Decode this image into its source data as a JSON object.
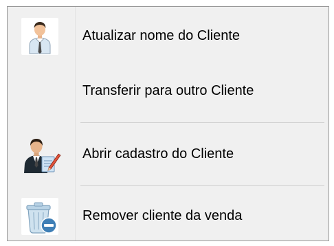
{
  "context_menu": {
    "items": [
      {
        "label": "Atualizar nome do Cliente",
        "icon": "person-icon"
      },
      {
        "label": "Transferir para outro Cliente",
        "icon": ""
      },
      {
        "label": "Abrir cadastro do Cliente",
        "icon": "person-edit-icon"
      },
      {
        "label": "Remover cliente da venda",
        "icon": "remove-icon"
      }
    ]
  }
}
